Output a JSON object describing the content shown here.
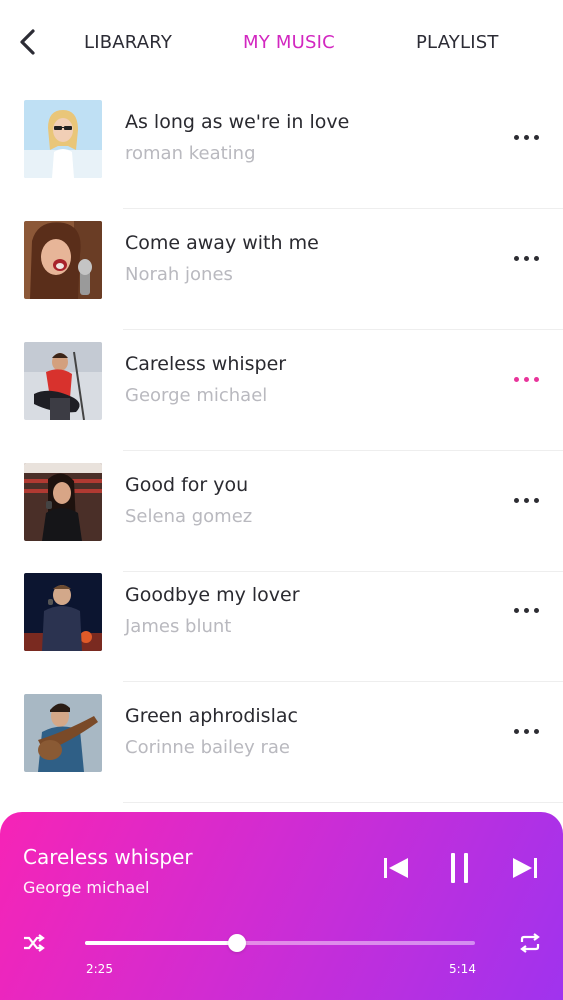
{
  "header": {
    "tabs": [
      {
        "label": "LIBARARY",
        "active": false
      },
      {
        "label": "MY MUSIC",
        "active": true
      },
      {
        "label": "PLAYLIST",
        "active": false
      }
    ]
  },
  "songs": [
    {
      "title": "As long as we're in love",
      "artist": "roman keating",
      "menu_active": false
    },
    {
      "title": "Come away with me",
      "artist": "Norah jones",
      "menu_active": false
    },
    {
      "title": "Careless whisper",
      "artist": "George michael",
      "menu_active": true
    },
    {
      "title": "Good for you",
      "artist": "Selena gomez",
      "menu_active": false
    },
    {
      "title": "Goodbye my lover",
      "artist": "James blunt",
      "menu_active": false
    },
    {
      "title": "Green aphrodislac",
      "artist": "Corinne bailey rae",
      "menu_active": false
    }
  ],
  "player": {
    "title": "Careless whisper",
    "artist": "George michael",
    "elapsed": "2:25",
    "total": "5:14",
    "progress": 0.39
  },
  "colors": {
    "accent": "#d227c0",
    "menu_active": "#e8339a",
    "player_gradient_start": "#f624b6",
    "player_gradient_end": "#a033ee"
  },
  "icons": {
    "back": "chevron-left-icon",
    "more": "more-dots-icon",
    "previous": "skip-previous-icon",
    "pause": "pause-icon",
    "next": "skip-next-icon",
    "shuffle": "shuffle-icon",
    "repeat": "repeat-icon"
  }
}
